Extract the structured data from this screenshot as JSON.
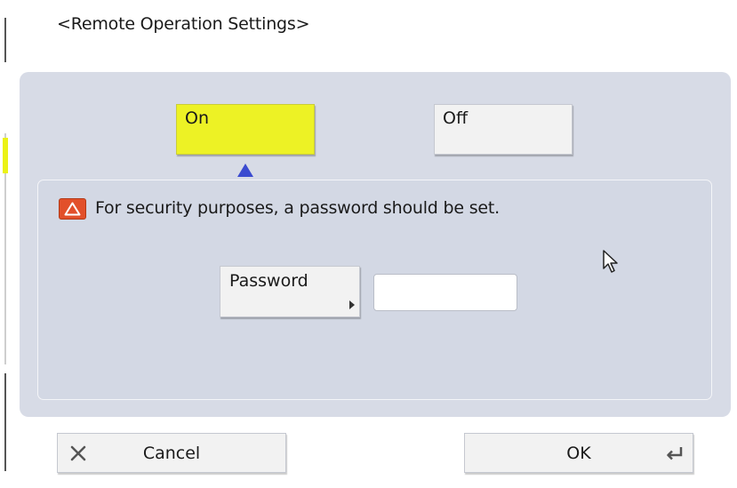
{
  "screen": {
    "title": "<Remote Operation Settings>"
  },
  "toggle": {
    "on_label": "On",
    "off_label": "Off",
    "selected": "On"
  },
  "warning": {
    "icon": "warning-triangle-icon",
    "message": "For security purposes, a password should be set."
  },
  "password": {
    "button_label": "Password",
    "field_value": ""
  },
  "footer": {
    "cancel_label": "Cancel",
    "ok_label": "OK"
  },
  "colors": {
    "selected_toggle": "#edf225",
    "panel": "#d7dbe6",
    "warning_icon": "#e2502a",
    "selector_arrow": "#3b4bd0"
  }
}
